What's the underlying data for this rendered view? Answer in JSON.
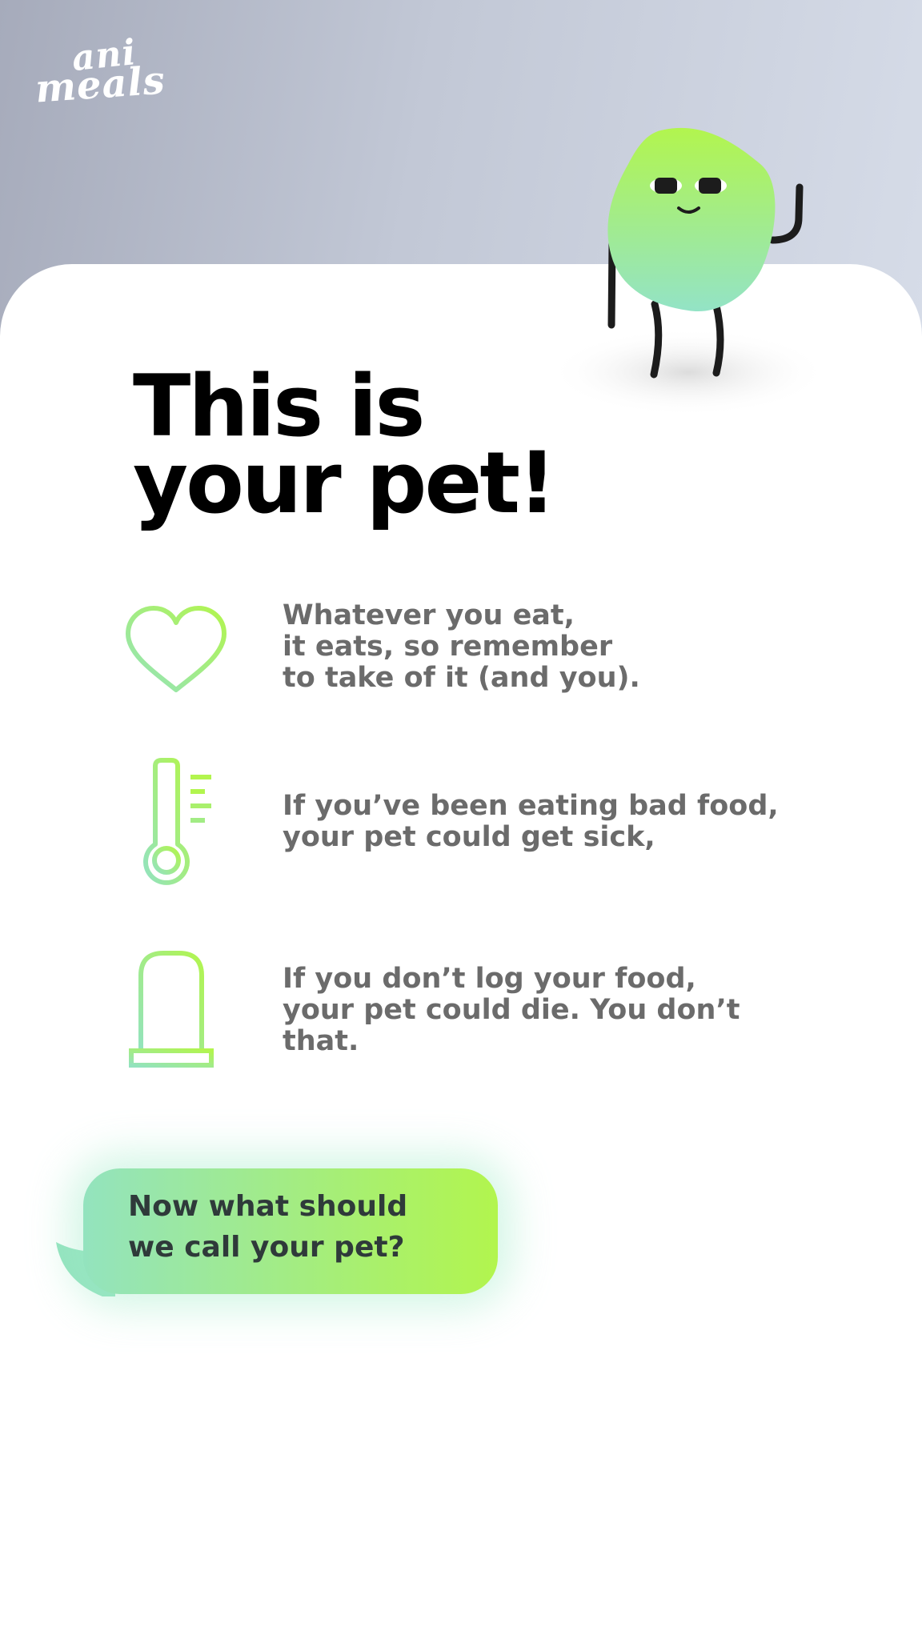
{
  "app": {
    "logo_line1": "ani",
    "logo_line2": "meals"
  },
  "main": {
    "headline": "This is\nyour pet!",
    "features": [
      {
        "icon": "heart-icon",
        "text": "Whatever you eat,\nit eats, so remember\nto take of it (and you)."
      },
      {
        "icon": "thermometer-icon",
        "text": "If you’ve been eating bad food,\nyour pet could get sick,"
      },
      {
        "icon": "gravestone-icon",
        "text": "If you don’t log your food,\nyour pet could die. You don’t\nthat."
      }
    ],
    "prompt_bubble": "Now what should\nwe call your pet?"
  },
  "colors": {
    "accent_green": "#aef255",
    "accent_mint": "#93e3be",
    "header_gray": "#c2c8d6",
    "body_text": "#6b6b6b"
  }
}
